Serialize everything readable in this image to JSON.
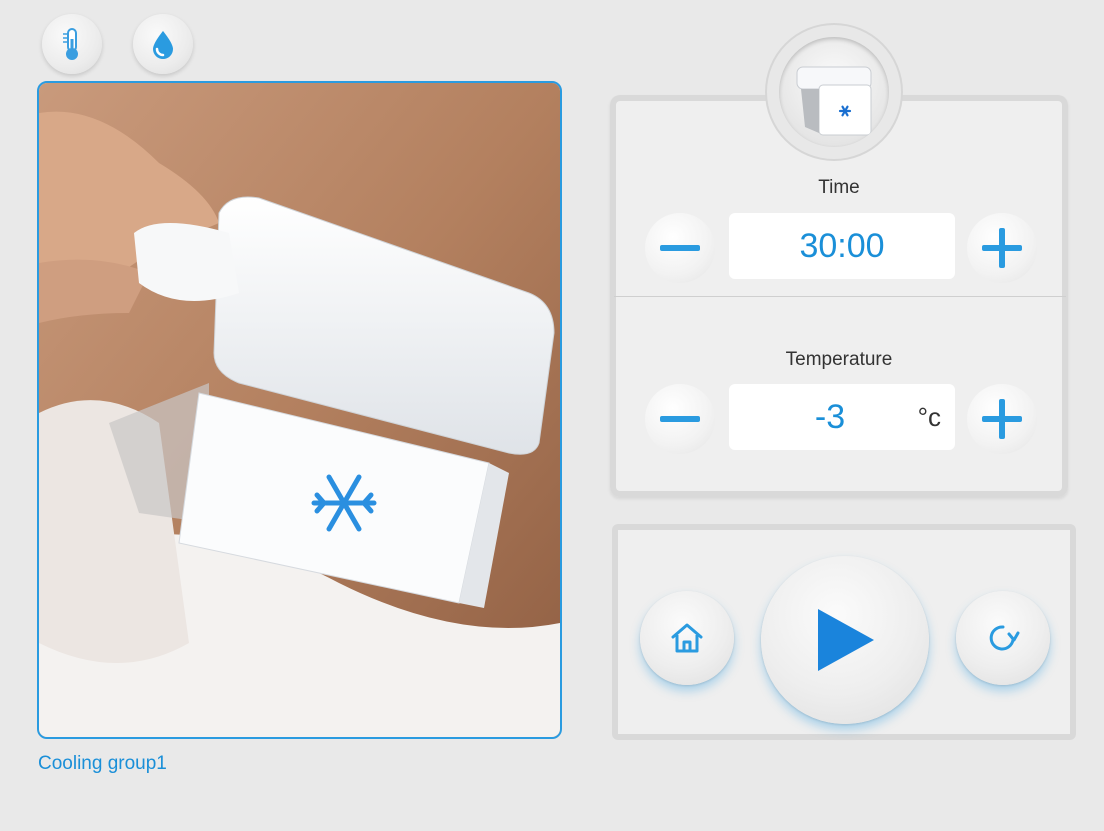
{
  "toolbar": {
    "icons": [
      "thermometer-icon",
      "water-drop-icon"
    ]
  },
  "preview": {
    "caption": "Cooling group1"
  },
  "settings": {
    "time": {
      "label": "Time",
      "value": "30:00"
    },
    "temperature": {
      "label": "Temperature",
      "value": "-3",
      "unit": "°c"
    }
  },
  "controls": {
    "icons": [
      "home-icon",
      "play-icon",
      "refresh-icon"
    ]
  },
  "colors": {
    "accent": "#1a8fd8",
    "background": "#e9e9e9"
  }
}
